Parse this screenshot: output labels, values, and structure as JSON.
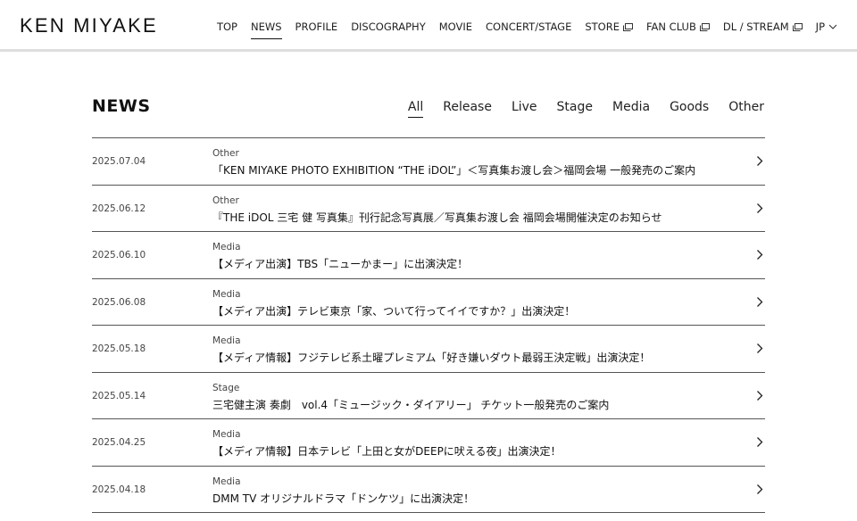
{
  "brand": {
    "logo": "KEN MIYAKE"
  },
  "nav": {
    "items": [
      {
        "label": "TOP",
        "active": false,
        "external": false
      },
      {
        "label": "NEWS",
        "active": true,
        "external": false
      },
      {
        "label": "PROFILE",
        "active": false,
        "external": false
      },
      {
        "label": "DISCOGRAPHY",
        "active": false,
        "external": false
      },
      {
        "label": "MOVIE",
        "active": false,
        "external": false
      },
      {
        "label": "CONCERT/STAGE",
        "active": false,
        "external": false
      },
      {
        "label": "STORE",
        "active": false,
        "external": true
      },
      {
        "label": "FAN CLUB",
        "active": false,
        "external": true
      },
      {
        "label": "DL / STREAM",
        "active": false,
        "external": true
      }
    ],
    "language": "JP"
  },
  "news": {
    "heading": "NEWS",
    "filters": [
      "All",
      "Release",
      "Live",
      "Stage",
      "Media",
      "Goods",
      "Other"
    ],
    "active_filter": "All",
    "items": [
      {
        "date": "2025.07.04",
        "category": "Other",
        "title": "「KEN MIYAKE PHOTO EXHIBITION “THE iDOL”」＜写真集お渡し会＞福岡会場 一般発売のご案内"
      },
      {
        "date": "2025.06.12",
        "category": "Other",
        "title": "『THE iDOL 三宅 健 写真集』刊行記念写真展／写真集お渡し会 福岡会場開催決定のお知らせ"
      },
      {
        "date": "2025.06.10",
        "category": "Media",
        "title": "【メディア出演】TBS「ニューかまー」に出演決定！"
      },
      {
        "date": "2025.06.08",
        "category": "Media",
        "title": "【メディア出演】テレビ東京「家、ついて行ってイイですか？」出演決定！"
      },
      {
        "date": "2025.05.18",
        "category": "Media",
        "title": "【メディア情報】フジテレビ系土曜プレミアム「好き嫌いダウト最弱王決定戦」出演決定！"
      },
      {
        "date": "2025.05.14",
        "category": "Stage",
        "title": "三宅健主演 奏劇　vol.4「ミュージック・ダイアリー」 チケット一般発売のご案内"
      },
      {
        "date": "2025.04.25",
        "category": "Media",
        "title": "【メディア情報】日本テレビ「上田と女がDEEPに吠える夜」出演決定！"
      },
      {
        "date": "2025.04.18",
        "category": "Media",
        "title": "DMM TV オリジナルドラマ「ドンケツ」に出演決定！"
      }
    ]
  },
  "icons": {
    "external": "external-window-icon",
    "language_dropdown": "chevron-down-icon",
    "row_arrow": "chevron-right-icon"
  }
}
